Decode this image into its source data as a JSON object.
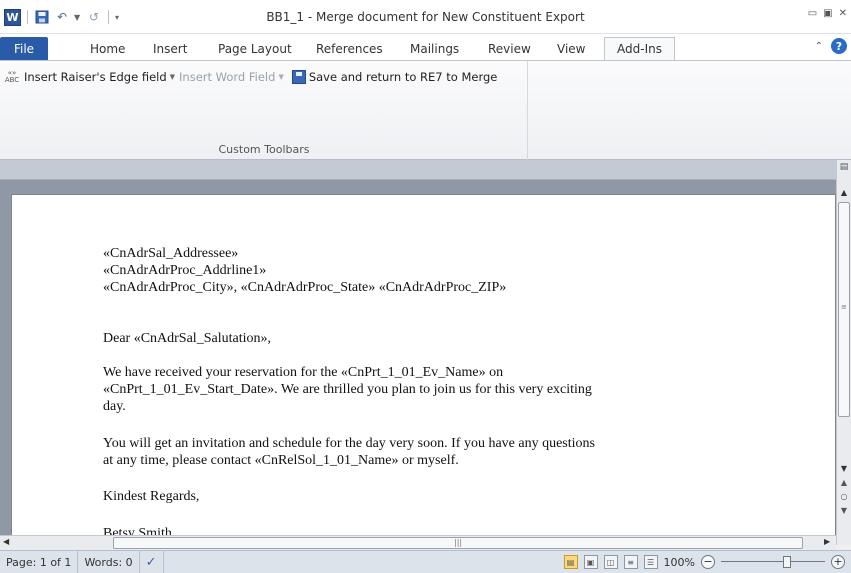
{
  "window": {
    "title": "BB1_1 - Merge document for New Constituent Export",
    "app_icon_letter": "W"
  },
  "tabs": [
    {
      "label": "File"
    },
    {
      "label": "Home"
    },
    {
      "label": "Insert"
    },
    {
      "label": "Page Layout"
    },
    {
      "label": "References"
    },
    {
      "label": "Mailings"
    },
    {
      "label": "Review"
    },
    {
      "label": "View"
    },
    {
      "label": "Add-Ins"
    }
  ],
  "ribbon": {
    "insert_re_field": "Insert Raiser's Edge field",
    "insert_word_field": "Insert Word Field",
    "save_return": "Save and return to RE7 to Merge",
    "group_label": "Custom Toolbars"
  },
  "document": {
    "lines": [
      "«CnAdrSal_Addressee»",
      "«CnAdrAdrProc_Addrline1»",
      "«CnAdrAdrProc_City», «CnAdrAdrProc_State» «CnAdrAdrProc_ZIP»",
      "Dear «CnAdrSal_Salutation»,",
      "We have received your reservation for the «CnPrt_1_01_Ev_Name» on",
      "«CnPrt_1_01_Ev_Start_Date». We are thrilled you plan to join us for this very exciting",
      "day.",
      "You will get an invitation and schedule for the day very soon. If you have any questions",
      "at any time, please contact «CnRelSol_1_01_Name» or myself.",
      "Kindest Regards,",
      "Betsy Smith"
    ]
  },
  "status": {
    "page": "Page: 1 of 1",
    "words": "Words: 0",
    "zoom": "100%"
  },
  "colors": {
    "file_tab": "#2a5ba8",
    "doc_background": "#8f98a5"
  }
}
